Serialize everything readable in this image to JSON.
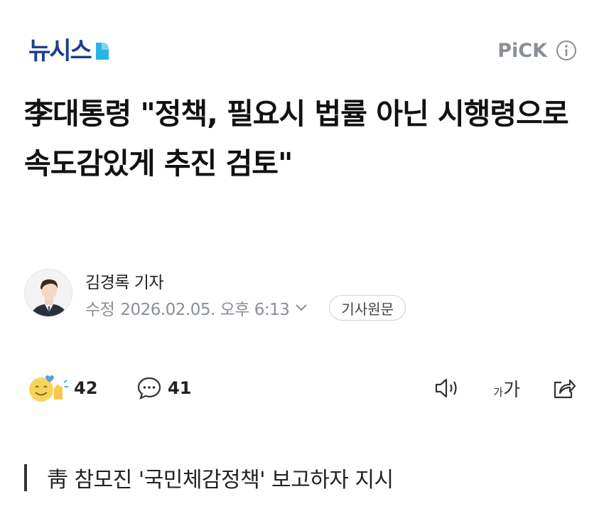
{
  "header": {
    "logo_text": "뉴시스",
    "pick_label": "PiCK",
    "icons": {
      "logo_mark": "newsis-logo-mark",
      "info": "info-icon"
    }
  },
  "article": {
    "headline": "李대통령 \"정책, 필요시 법률 아닌 시행령으로 속도감있게 추진 검토\"",
    "reporter": "김경록 기자",
    "modified_label": "수정",
    "modified_date": "2026.02.05. 오후 6:13",
    "original_button": "기사원문",
    "subheading": "靑 참모진 '국민체감정책' 보고하자 지시"
  },
  "actions": {
    "reaction_count": "42",
    "comment_count": "41",
    "font_small": "가",
    "font_big": "가",
    "icons": {
      "reaction": "reaction-emoji-icon",
      "comment": "comment-icon",
      "speaker": "speaker-icon",
      "share": "share-icon"
    }
  },
  "colors": {
    "logo": "#1d3f8f",
    "logo_accent": "#2bb3e8",
    "muted": "#8a8f96"
  }
}
